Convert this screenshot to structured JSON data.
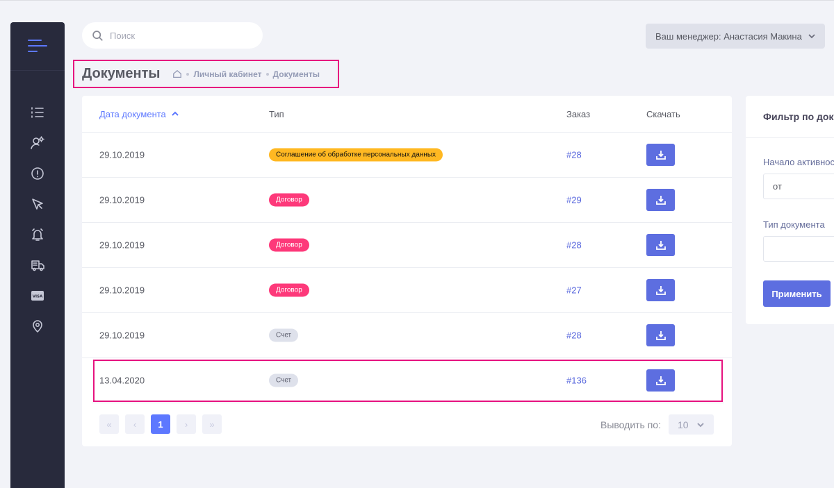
{
  "search": {
    "placeholder": "Поиск"
  },
  "manager": {
    "label": "Ваш менеджер: Анастасия Макина"
  },
  "subheader": {
    "title": "Документы",
    "breadcrumbs": [
      "Личный кабинет",
      "Документы"
    ]
  },
  "sidebar": {
    "items": [
      {
        "icon": "list-icon"
      },
      {
        "icon": "user-settings-icon"
      },
      {
        "icon": "alert-circle-icon"
      },
      {
        "icon": "rocket-icon"
      },
      {
        "icon": "bell-icon"
      },
      {
        "icon": "truck-icon"
      },
      {
        "icon": "visa-card-icon"
      },
      {
        "icon": "map-pin-icon"
      }
    ]
  },
  "table": {
    "columns": {
      "date": "Дата документа",
      "type": "Тип",
      "order": "Заказ",
      "download": "Скачать"
    },
    "rows": [
      {
        "date": "29.10.2019",
        "type": "Соглашение об обработке персональных данных",
        "type_color": "#ffb822",
        "type_text_color": "#111111",
        "order": "#28"
      },
      {
        "date": "29.10.2019",
        "type": "Договор",
        "type_color": "#fd397a",
        "type_text_color": "#ffffff",
        "order": "#29"
      },
      {
        "date": "29.10.2019",
        "type": "Договор",
        "type_color": "#fd397a",
        "type_text_color": "#ffffff",
        "order": "#28"
      },
      {
        "date": "29.10.2019",
        "type": "Договор",
        "type_color": "#fd397a",
        "type_text_color": "#ffffff",
        "order": "#27"
      },
      {
        "date": "29.10.2019",
        "type": "Счет",
        "type_color": "#dee1eb",
        "type_text_color": "#5a5c6b",
        "order": "#28"
      },
      {
        "date": "13.04.2020",
        "type": "Счет",
        "type_color": "#dee1eb",
        "type_text_color": "#5a5c6b",
        "order": "#136"
      }
    ]
  },
  "pagination": {
    "first": "«",
    "prev": "‹",
    "current": "1",
    "next": "›",
    "last": "»",
    "per_page_label": "Выводить по:",
    "per_page_value": "10"
  },
  "filter": {
    "title": "Фильтр по документам",
    "start_label": "Начало активности",
    "start_placeholder": "от",
    "type_label": "Тип документа",
    "type_value": "",
    "apply": "Применить"
  },
  "colors": {
    "accent": "#5d78ff",
    "button": "#5d6ee0",
    "highlight": "#e6127f",
    "sidebar": "#282a3c"
  }
}
